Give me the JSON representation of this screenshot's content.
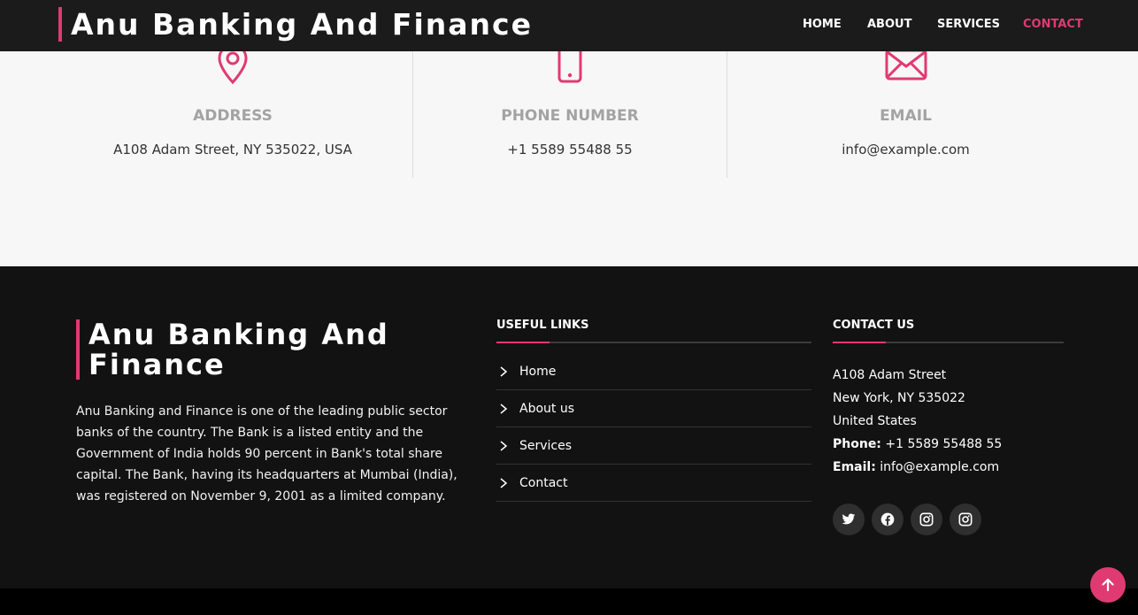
{
  "header": {
    "brand": "Anu Banking And Finance",
    "nav": [
      {
        "label": "HOME",
        "active": false
      },
      {
        "label": "ABOUT",
        "active": false
      },
      {
        "label": "SERVICES",
        "active": false
      },
      {
        "label": "CONTACT",
        "active": true
      }
    ]
  },
  "info": [
    {
      "icon": "location-pin-icon",
      "title": "ADDRESS",
      "value": "A108 Adam Street, NY 535022, USA"
    },
    {
      "icon": "phone-icon",
      "title": "PHONE NUMBER",
      "value": "+1 5589 55488 55"
    },
    {
      "icon": "envelope-icon",
      "title": "EMAIL",
      "value": "info@example.com"
    }
  ],
  "footer": {
    "brand": "Anu Banking And Finance",
    "about": "Anu Banking and Finance is one of the leading public sector banks of the country. The Bank is a listed entity and the Government of India holds 90 percent in Bank's total share capital. The Bank, having its headquarters at Mumbai (India), was registered on November 9, 2001 as a limited company.",
    "useful_links": {
      "heading": "USEFUL LINKS",
      "items": [
        "Home",
        "About us",
        "Services",
        "Contact"
      ]
    },
    "contact": {
      "heading": "CONTACT US",
      "street": "A108 Adam Street",
      "city": "New York, NY 535022",
      "country": "United States",
      "phone_label": "Phone:",
      "phone": "+1 5589 55488 55",
      "email_label": "Email:",
      "email": "info@example.com"
    },
    "socials": [
      "twitter-icon",
      "facebook-icon",
      "instagram-icon",
      "instagram-icon"
    ]
  },
  "colors": {
    "accent": "#e03a73",
    "header_bg": "#1b1b1b",
    "footer_bg": "#121212",
    "info_bg": "#f7f7f7"
  }
}
